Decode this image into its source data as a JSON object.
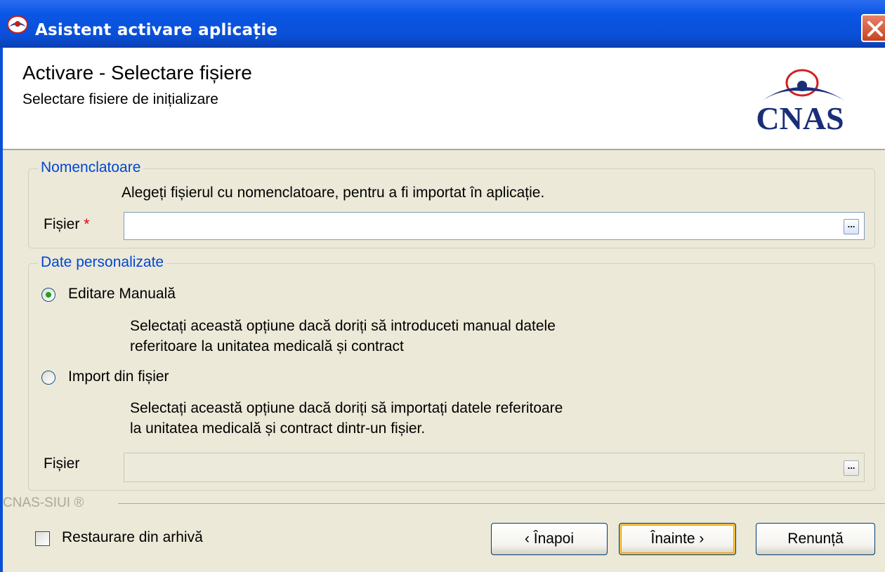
{
  "window": {
    "title": "Asistent activare aplicație",
    "close_icon": "close-icon",
    "app_icon": "cnas-app-icon"
  },
  "header": {
    "title": "Activare - Selectare fișiere",
    "subtitle": "Selectare fisiere de inițializare",
    "logo_text": "CNAS"
  },
  "nomenclatoare": {
    "legend": "Nomenclatoare",
    "description": "Alegeți fișierul cu nomenclatoare, pentru a fi importat în aplicație.",
    "file_label": "Fișier",
    "required_marker": "*",
    "file_value": "",
    "browse_label": "..."
  },
  "date_personalizate": {
    "legend": "Date personalizate",
    "option_manual": {
      "label": "Editare Manuală",
      "selected": true,
      "desc_line1": "Selectați această opțiune dacă doriți să introduceti manual datele",
      "desc_line2": "referitoare la unitatea medicală și contract"
    },
    "option_import": {
      "label": "Import din fișier",
      "selected": false,
      "desc_line1": "Selectați această opțiune dacă doriți să importați datele referitoare",
      "desc_line2": "la unitatea medicală și contract dintr-un fișier."
    },
    "file_label": "Fișier",
    "file_value": "",
    "browse_label": "..."
  },
  "footer": {
    "copyright": "CNAS-SIUI ®",
    "restore_label": "Restaurare din arhivă",
    "restore_checked": false,
    "back_label": "‹ Înapoi",
    "next_label": "Înainte ›",
    "cancel_label": "Renunță"
  },
  "colors": {
    "titlebar": "#0a4fd8",
    "legend_text": "#0046d5",
    "window_bg": "#ece9d8",
    "required": "#e00000",
    "radio_selected": "#21a121"
  }
}
